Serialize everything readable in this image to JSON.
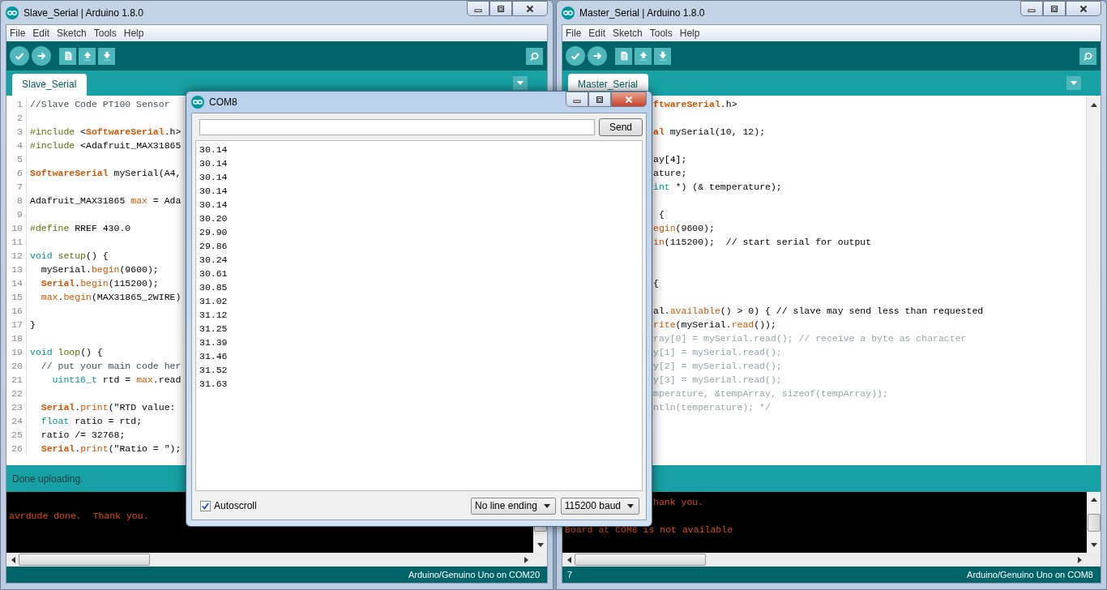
{
  "windows": [
    {
      "title": "Slave_Serial | Arduino 1.8.0",
      "menu": [
        "File",
        "Edit",
        "Sketch",
        "Tools",
        "Help"
      ],
      "tabs": [
        {
          "label": "Slave_Serial",
          "selected": true
        }
      ],
      "lines": [
        {
          "number": "1",
          "kind": "code",
          "segs": [
            {
              "text": "//Slave Code PT100 Sensor",
              "kind": "note"
            }
          ]
        },
        {
          "number": "2",
          "kind": "blank"
        },
        {
          "number": "3",
          "kind": "code",
          "segs": [
            {
              "text": "#include",
              "kind": "directive"
            },
            {
              "text": " <",
              "kind": "plain"
            },
            {
              "text": "SoftwareSerial",
              "kind": "keyword"
            },
            {
              "text": ".h>",
              "kind": "plain"
            }
          ]
        },
        {
          "number": "4",
          "kind": "code",
          "segs": [
            {
              "text": "#include",
              "kind": "directive"
            },
            {
              "text": " <Adafruit_MAX31865",
              "kind": "plain"
            }
          ]
        },
        {
          "number": "5",
          "kind": "blank"
        },
        {
          "number": "6",
          "kind": "code",
          "segs": [
            {
              "text": "SoftwareSerial",
              "kind": "keyword"
            },
            {
              "text": " mySerial(A4,",
              "kind": "plain"
            }
          ]
        },
        {
          "number": "7",
          "kind": "blank"
        },
        {
          "number": "8",
          "kind": "code",
          "segs": [
            {
              "text": "Adafruit_MAX31865 ",
              "kind": "plain"
            },
            {
              "text": "max",
              "kind": "function"
            },
            {
              "text": " = Ada",
              "kind": "plain"
            }
          ]
        },
        {
          "number": "9",
          "kind": "blank"
        },
        {
          "number": "10",
          "kind": "code",
          "segs": [
            {
              "text": "#define",
              "kind": "directive"
            },
            {
              "text": " RREF 430.0",
              "kind": "plain"
            }
          ]
        },
        {
          "number": "11",
          "kind": "blank"
        },
        {
          "number": "12",
          "kind": "code",
          "segs": [
            {
              "text": "void ",
              "kind": "type"
            },
            {
              "text": "setup",
              "kind": "directive"
            },
            {
              "text": "() {",
              "kind": "plain"
            }
          ]
        },
        {
          "number": "13",
          "kind": "code",
          "segs": [
            {
              "text": "  mySerial.",
              "kind": "plain"
            },
            {
              "text": "begin",
              "kind": "function"
            },
            {
              "text": "(9600);",
              "kind": "plain"
            }
          ]
        },
        {
          "number": "14",
          "kind": "code",
          "segs": [
            {
              "text": "  Serial",
              "kind": "keyword"
            },
            {
              "text": ".",
              "kind": "plain"
            },
            {
              "text": "begin",
              "kind": "function"
            },
            {
              "text": "(115200);",
              "kind": "plain"
            }
          ]
        },
        {
          "number": "15",
          "kind": "code",
          "segs": [
            {
              "text": "  max",
              "kind": "function"
            },
            {
              "text": ".",
              "kind": "plain"
            },
            {
              "text": "begin",
              "kind": "function"
            },
            {
              "text": "(MAX31865_2WIRE)",
              "kind": "plain"
            }
          ]
        },
        {
          "number": "16",
          "kind": "blank"
        },
        {
          "number": "17",
          "kind": "code",
          "segs": [
            {
              "text": "}",
              "kind": "plain"
            }
          ]
        },
        {
          "number": "18",
          "kind": "blank"
        },
        {
          "number": "19",
          "kind": "code",
          "segs": [
            {
              "text": "void ",
              "kind": "type"
            },
            {
              "text": "loop",
              "kind": "directive"
            },
            {
              "text": "() {",
              "kind": "plain"
            }
          ]
        },
        {
          "number": "20",
          "kind": "code",
          "segs": [
            {
              "text": "  // put your main code her",
              "kind": "note"
            }
          ]
        },
        {
          "number": "21",
          "kind": "code",
          "segs": [
            {
              "text": "    uint16_t",
              "kind": "type"
            },
            {
              "text": " rtd = ",
              "kind": "plain"
            },
            {
              "text": "max",
              "kind": "function"
            },
            {
              "text": ".read",
              "kind": "plain"
            }
          ]
        },
        {
          "number": "22",
          "kind": "blank"
        },
        {
          "number": "23",
          "kind": "code",
          "segs": [
            {
              "text": "  Serial",
              "kind": "keyword"
            },
            {
              "text": ".",
              "kind": "plain"
            },
            {
              "text": "print",
              "kind": "function"
            },
            {
              "text": "(\"RTD value:",
              "kind": "plain"
            }
          ]
        },
        {
          "number": "24",
          "kind": "code",
          "segs": [
            {
              "text": "  float",
              "kind": "type"
            },
            {
              "text": " ratio = rtd;",
              "kind": "plain"
            }
          ]
        },
        {
          "number": "25",
          "kind": "code",
          "segs": [
            {
              "text": "  ratio /= 32768;",
              "kind": "plain"
            }
          ]
        },
        {
          "number": "26",
          "kind": "code",
          "segs": [
            {
              "text": "  Serial",
              "kind": "keyword"
            },
            {
              "text": ".",
              "kind": "plain"
            },
            {
              "text": "print",
              "kind": "function"
            },
            {
              "text": "(\"Ratio = \");",
              "kind": "plain"
            }
          ]
        }
      ],
      "status": "Done uploading.",
      "console": [
        {
          "kind": "blank"
        },
        {
          "kind": "plain",
          "text": "avrdude done.  Thank you."
        }
      ],
      "board": "Arduino/Genuino Uno on COM20"
    },
    {
      "title": "Master_Serial | Arduino 1.8.0",
      "menu": [
        "File",
        "Edit",
        "Sketch",
        "Tools",
        "Help"
      ],
      "tabs": [
        {
          "label": "Master_Serial",
          "selected": true
        }
      ],
      "lines": [
        {
          "kind": "code",
          "segs": [
            {
              "text": "ftwareSerial",
              "kind": "keyword"
            },
            {
              "text": ".h>",
              "kind": "plain"
            }
          ]
        },
        {
          "kind": "blank"
        },
        {
          "kind": "code",
          "segs": [
            {
              "text": "al",
              "kind": "keyword"
            },
            {
              "text": " mySerial(10, 12);",
              "kind": "plain"
            }
          ]
        },
        {
          "kind": "blank"
        },
        {
          "kind": "code",
          "segs": [
            {
              "text": "ay[4];",
              "kind": "plain"
            }
          ]
        },
        {
          "kind": "code",
          "segs": [
            {
              "text": "ature;",
              "kind": "plain"
            }
          ]
        },
        {
          "kind": "code",
          "segs": [
            {
              "text": "int",
              "kind": "type"
            },
            {
              "text": " *) (& temperature);",
              "kind": "plain"
            }
          ]
        },
        {
          "kind": "blank"
        },
        {
          "kind": "code",
          "segs": [
            {
              "text": " {",
              "kind": "plain"
            }
          ]
        },
        {
          "kind": "code",
          "segs": [
            {
              "text": "egin",
              "kind": "function"
            },
            {
              "text": "(9600);",
              "kind": "plain"
            }
          ]
        },
        {
          "kind": "code",
          "segs": [
            {
              "text": "in",
              "kind": "function"
            },
            {
              "text": "(115200);  // start serial for output",
              "kind": "plain"
            }
          ]
        },
        {
          "kind": "blank"
        },
        {
          "kind": "blank"
        },
        {
          "kind": "code",
          "segs": [
            {
              "text": "{",
              "kind": "plain"
            }
          ]
        },
        {
          "kind": "blank"
        },
        {
          "kind": "code",
          "segs": [
            {
              "text": "al.",
              "kind": "plain"
            },
            {
              "text": "available",
              "kind": "function"
            },
            {
              "text": "() > 0) { // slave may send less than requested",
              "kind": "plain"
            }
          ]
        },
        {
          "kind": "code",
          "segs": [
            {
              "text": "rite",
              "kind": "function"
            },
            {
              "text": "(mySerial.",
              "kind": "plain"
            },
            {
              "text": "read",
              "kind": "function"
            },
            {
              "text": "());",
              "kind": "plain"
            }
          ]
        },
        {
          "kind": "code",
          "segs": [
            {
              "text": "ray[0] = mySerial.read(); // receive a byte as character",
              "kind": "comment"
            }
          ]
        },
        {
          "kind": "code",
          "segs": [
            {
              "text": "y[1] = mySerial.read();",
              "kind": "comment"
            }
          ]
        },
        {
          "kind": "code",
          "segs": [
            {
              "text": "y[2] = mySerial.read();",
              "kind": "comment"
            }
          ]
        },
        {
          "kind": "code",
          "segs": [
            {
              "text": "y[3] = mySerial.read();",
              "kind": "comment"
            }
          ]
        },
        {
          "kind": "code",
          "segs": [
            {
              "text": "mperature, &tempArray, sizeof(tempArray));",
              "kind": "comment"
            }
          ]
        },
        {
          "kind": "code",
          "segs": [
            {
              "text": "ntln(temperature); */",
              "kind": "comment"
            }
          ]
        }
      ],
      "console": [
        {
          "kind": "cut",
          "text": "hank you."
        },
        {
          "kind": "blank"
        },
        {
          "kind": "plain",
          "text": "Board at COM8 is not available"
        }
      ],
      "line_indicator": "7",
      "board": "Arduino/Genuino Uno on COM8"
    }
  ],
  "serial_monitor": {
    "title": "COM8",
    "send": "Send",
    "output": [
      "30.14",
      "30.14",
      "30.14",
      "30.14",
      "30.14",
      "30.20",
      "29.90",
      "29.86",
      "30.24",
      "30.61",
      "30.85",
      "31.02",
      "31.12",
      "31.25",
      "31.39",
      "31.46",
      "31.52",
      "31.63"
    ],
    "autoscroll": {
      "label": "Autoscroll",
      "checked": true
    },
    "line_ending": "No line ending",
    "baud": "115200 baud"
  }
}
